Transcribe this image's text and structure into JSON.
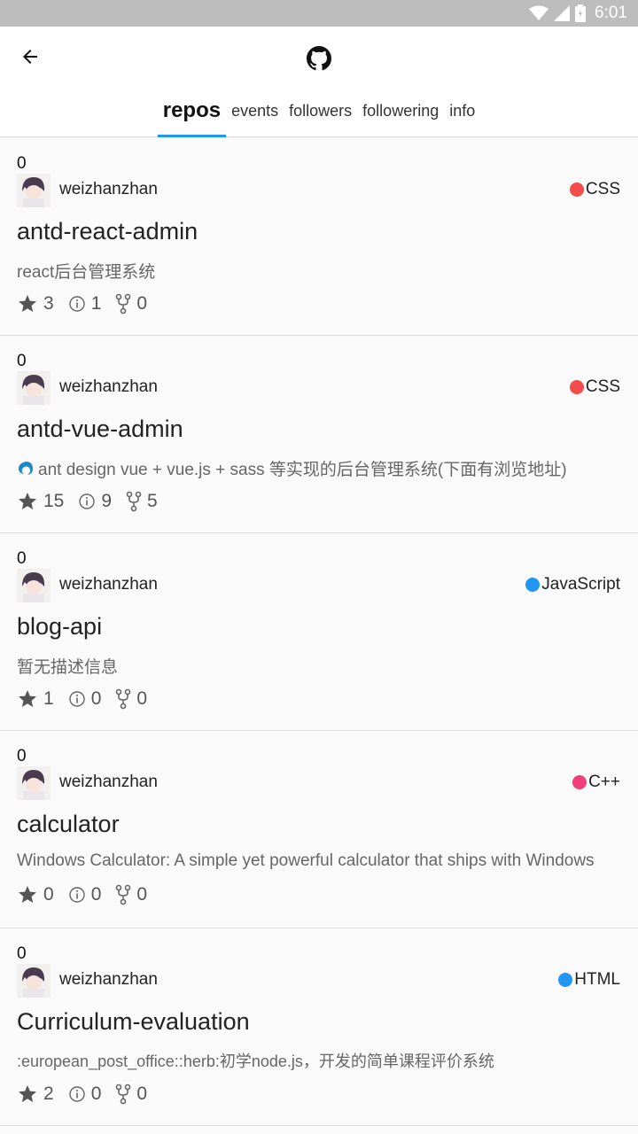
{
  "status_bar": {
    "time": "6:01"
  },
  "header": {
    "back_icon": "arrow-left-icon",
    "logo_icon": "github-icon",
    "tabs": [
      {
        "label": "repos",
        "active": true
      },
      {
        "label": "events",
        "active": false
      },
      {
        "label": "followers",
        "active": false
      },
      {
        "label": "followering",
        "active": false
      },
      {
        "label": "info",
        "active": false
      }
    ]
  },
  "repos": [
    {
      "rank": "0",
      "owner": "weizhanzhan",
      "language": "CSS",
      "lang_color": "#f44b4b",
      "name": "antd-react-admin",
      "description": "react后台管理系统",
      "desc_icon": false,
      "stars": "3",
      "issues": "1",
      "forks": "0"
    },
    {
      "rank": "0",
      "owner": "weizhanzhan",
      "language": "CSS",
      "lang_color": "#f44b4b",
      "name": "antd-vue-admin",
      "description": "ant design vue + vue.js + sass 等实现的后台管理系统(下面有浏览地址)",
      "desc_icon": true,
      "stars": "15",
      "issues": "9",
      "forks": "5"
    },
    {
      "rank": "0",
      "owner": "weizhanzhan",
      "language": "JavaScript",
      "lang_color": "#2196f3",
      "name": "blog-api",
      "description": "暂无描述信息",
      "desc_icon": false,
      "stars": "1",
      "issues": "0",
      "forks": "0"
    },
    {
      "rank": "0",
      "owner": "weizhanzhan",
      "language": "C++",
      "lang_color": "#f0407a",
      "name": "calculator",
      "description": "Windows Calculator: A simple yet powerful calculator that ships with Windows",
      "desc_icon": false,
      "stars": "0",
      "issues": "0",
      "forks": "0"
    },
    {
      "rank": "0",
      "owner": "weizhanzhan",
      "language": "HTML",
      "lang_color": "#2196f3",
      "name": "Curriculum-evaluation",
      "description": ":european_post_office::herb:初学node.js，开发的简单课程评价系统",
      "desc_icon": false,
      "stars": "2",
      "issues": "0",
      "forks": "0"
    }
  ]
}
